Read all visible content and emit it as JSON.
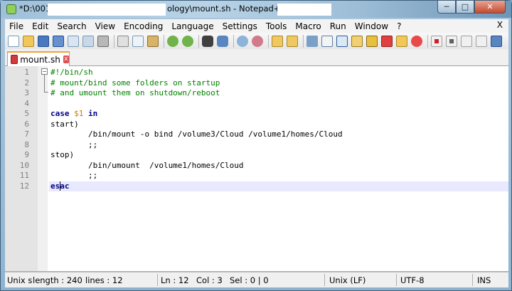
{
  "window": {
    "title_prefix": "*D:\\001",
    "title_mid": "ology\\mount.sh - Notepad++",
    "minimize": "─",
    "maximize": "□",
    "close": "✕"
  },
  "menu": {
    "items": [
      "File",
      "Edit",
      "Search",
      "View",
      "Encoding",
      "Language",
      "Settings",
      "Tools",
      "Macro",
      "Run",
      "Window",
      "?"
    ],
    "close_label": "X"
  },
  "tab": {
    "label": "mount.sh",
    "close": "x"
  },
  "editor": {
    "line_numbers": [
      "1",
      "2",
      "3",
      "4",
      "5",
      "6",
      "7",
      "8",
      "9",
      "10",
      "11",
      "12"
    ],
    "lines": [
      {
        "segments": [
          {
            "t": "#!/bin/sh",
            "c": "cmt"
          }
        ]
      },
      {
        "segments": [
          {
            "t": "# mount/bind some folders on startup",
            "c": "cmt"
          }
        ]
      },
      {
        "segments": [
          {
            "t": "# and umount them on shutdown/reboot",
            "c": "cmt"
          }
        ]
      },
      {
        "segments": []
      },
      {
        "segments": [
          {
            "t": "case ",
            "c": "kw"
          },
          {
            "t": "$1",
            "c": "var"
          },
          {
            "t": " in",
            "c": "kw"
          }
        ]
      },
      {
        "segments": [
          {
            "t": "start)",
            "c": "plain"
          }
        ]
      },
      {
        "segments": [
          {
            "t": "        /bin/mount -o bind /volume3/Cloud /volume1/homes/Cloud",
            "c": "plain"
          }
        ]
      },
      {
        "segments": [
          {
            "t": "        ;;",
            "c": "plain"
          }
        ]
      },
      {
        "segments": [
          {
            "t": "stop)",
            "c": "plain"
          }
        ]
      },
      {
        "segments": [
          {
            "t": "        /bin/umount  /volume1/homes/Cloud",
            "c": "plain"
          }
        ]
      },
      {
        "segments": [
          {
            "t": "        ;;",
            "c": "plain"
          }
        ]
      },
      {
        "segments": [
          {
            "t": "es",
            "c": "kw"
          },
          {
            "t": "|",
            "c": "caret"
          },
          {
            "t": "ac",
            "c": "kw"
          }
        ]
      }
    ],
    "current_line": 12
  },
  "status": {
    "file_type": "Unix s",
    "length": "length : 240",
    "lines": "lines : 12",
    "ln": "Ln : 12",
    "col": "Col : 3",
    "sel": "Sel : 0 | 0",
    "eol": "Unix (LF)",
    "encoding": "UTF-8",
    "mode": "INS"
  },
  "toolbar_icons": [
    "new-file-icon",
    "open-file-icon",
    "save-icon",
    "save-all-icon",
    "close-icon",
    "close-all-icon",
    "print-icon",
    "cut-icon",
    "copy-icon",
    "paste-icon",
    "undo-icon",
    "redo-icon",
    "find-icon",
    "replace-icon",
    "zoom-in-icon",
    "zoom-out-icon",
    "sync-vertical-icon",
    "sync-horizontal-icon",
    "word-wrap-icon",
    "show-all-chars-icon",
    "indent-guide-icon",
    "user-defined-lang-icon",
    "doc-map-icon",
    "function-list-icon",
    "folder-as-workspace-icon",
    "monitoring-icon",
    "record-macro-icon",
    "stop-record-icon",
    "play-macro-icon",
    "play-multiple-icon",
    "save-macro-icon"
  ]
}
